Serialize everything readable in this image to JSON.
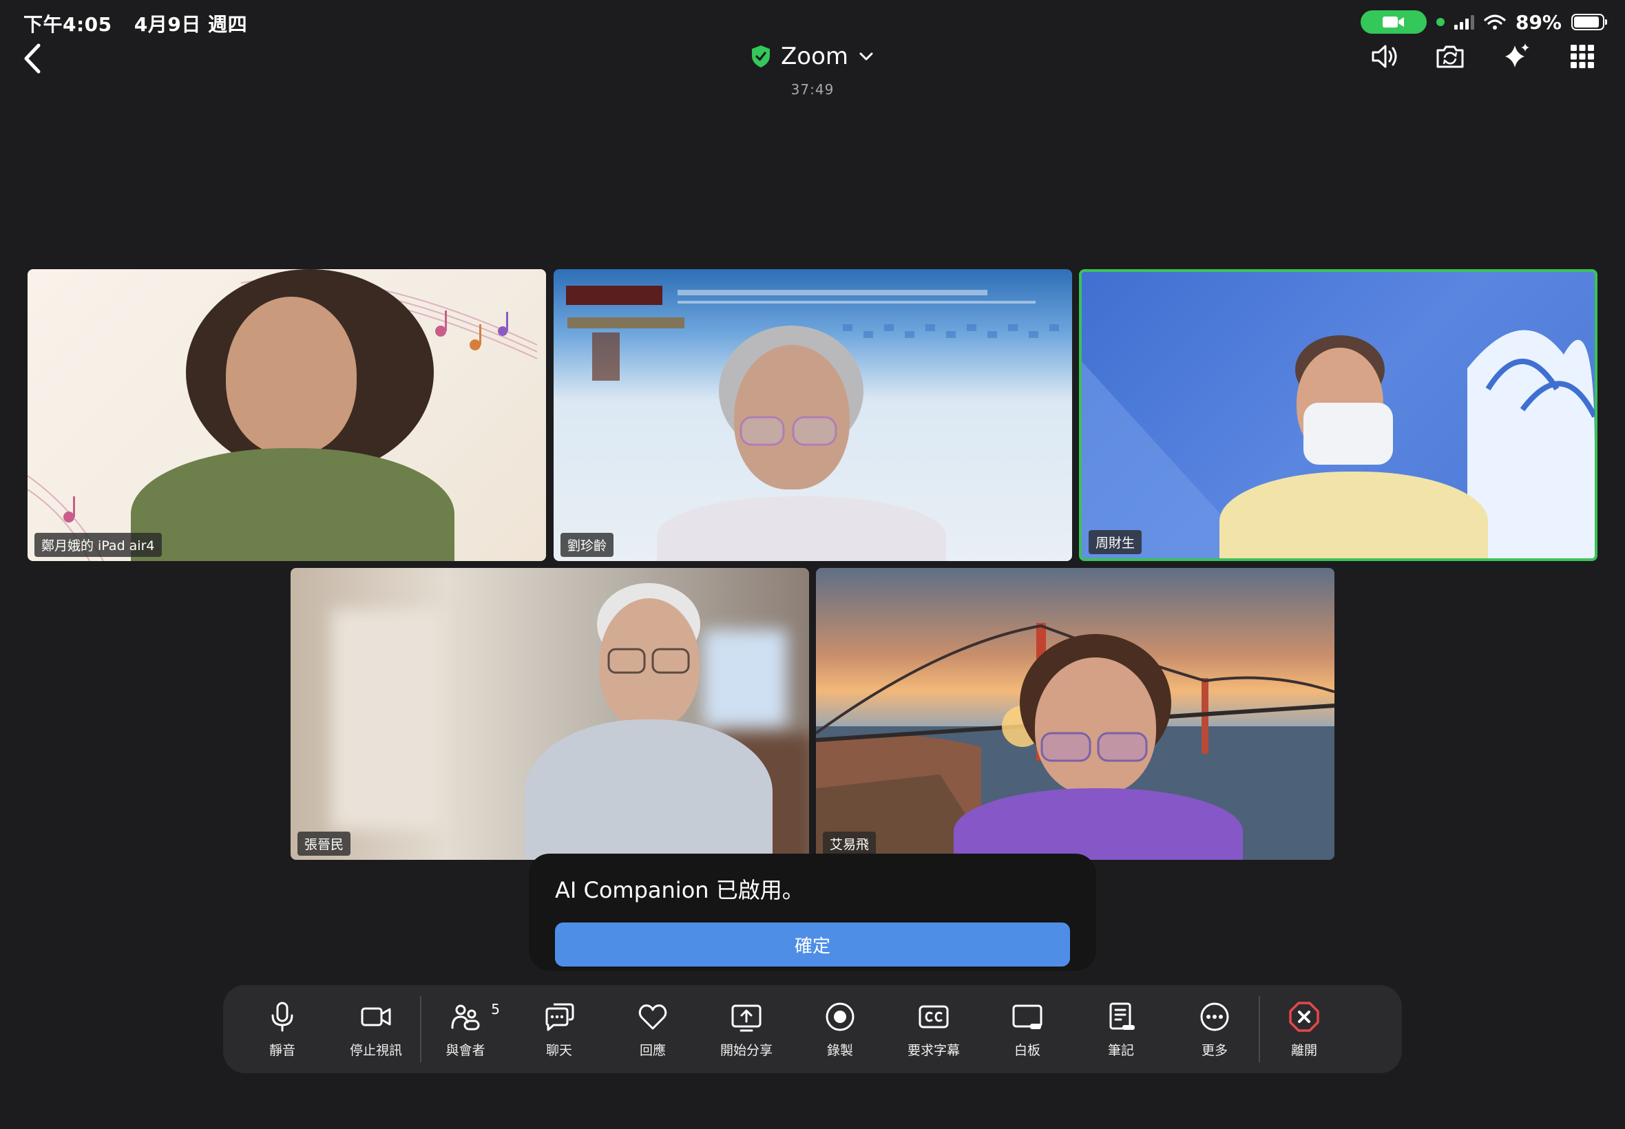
{
  "status_bar": {
    "time": "下午4:05",
    "date": "4月9日 週四",
    "battery": "89%",
    "battery_level": 0.89
  },
  "header": {
    "title": "Zoom",
    "timer": "37:49",
    "icons": [
      "speaker-icon",
      "camera-switch-icon",
      "sparkle-icon",
      "grid-icon"
    ]
  },
  "participants": [
    {
      "name": "鄭月娥的 iPad air4",
      "active": false
    },
    {
      "name": "劉珍齡",
      "active": false
    },
    {
      "name": "周財生",
      "active": true
    },
    {
      "name": "張晉民",
      "active": false
    },
    {
      "name": "艾易飛",
      "active": false
    }
  ],
  "toast": {
    "message": "AI Companion 已啟用。",
    "confirm": "確定"
  },
  "toolbar": {
    "mute": "靜音",
    "stop_video": "停止視訊",
    "participants": "與會者",
    "participants_count": "5",
    "chat": "聊天",
    "reactions": "回應",
    "share": "開始分享",
    "record": "錄製",
    "captions": "要求字幕",
    "whiteboard": "白板",
    "notes": "筆記",
    "more": "更多",
    "leave": "離開"
  },
  "colors": {
    "active_border": "#3ac25a",
    "confirm_button": "#4f8ee6",
    "leave_icon": "#e5484d",
    "shield": "#34c759"
  }
}
